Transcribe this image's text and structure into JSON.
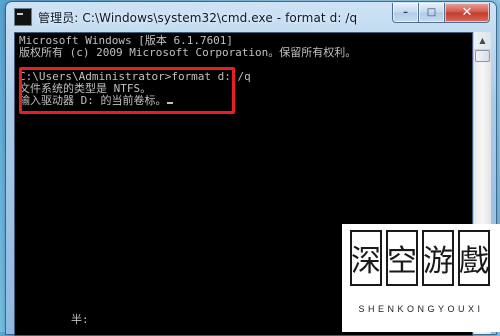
{
  "window": {
    "title": "管理员: C:\\Windows\\system32\\cmd.exe - format  d: /q",
    "caption": {
      "minimize": "–",
      "maximize": "□",
      "close": "✕"
    }
  },
  "console": {
    "lines": [
      "Microsoft Windows [版本 6.1.7601]",
      "版权所有 (c) 2009 Microsoft Corporation。保留所有权利。",
      "",
      "C:\\Users\\Administrator>format d: /q",
      "文件系统的类型是 NTFS。",
      "输入驱动器 D: 的当前卷标。"
    ],
    "ime_status": "半:"
  },
  "scrollbar": {
    "up_arrow": "▲"
  },
  "watermark": {
    "chars": [
      "深",
      "空",
      "游",
      "戲"
    ],
    "subtitle": "SHENKONGYOUXI"
  },
  "colors": {
    "console_bg": "#000000",
    "console_text": "#c0c0c0",
    "highlight_border": "#ea1c24",
    "close_button": "#c9473a"
  }
}
